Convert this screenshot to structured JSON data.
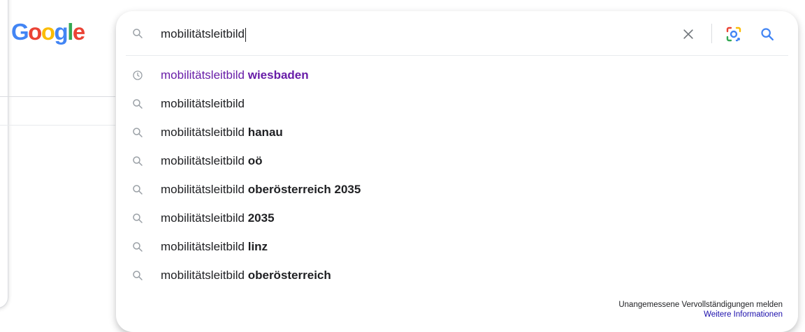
{
  "logo": {
    "text": "Google",
    "letters": [
      {
        "ch": "G",
        "color": "#4285F4"
      },
      {
        "ch": "o",
        "color": "#EA4335"
      },
      {
        "ch": "o",
        "color": "#FBBC05"
      },
      {
        "ch": "g",
        "color": "#4285F4"
      },
      {
        "ch": "l",
        "color": "#34A853"
      },
      {
        "ch": "e",
        "color": "#EA4335"
      }
    ]
  },
  "search": {
    "query": "mobilitätsleitbild",
    "icon": "search-icon",
    "clear_icon": "close-icon",
    "lens_icon": "google-lens-icon",
    "submit_icon": "search-icon"
  },
  "suggestions": [
    {
      "base": "mobilitätsleitbild",
      "suffix": " wiesbaden",
      "icon": "history-icon",
      "visited": true
    },
    {
      "base": "mobilitätsleitbild",
      "suffix": "",
      "icon": "search-icon",
      "visited": false
    },
    {
      "base": "mobilitätsleitbild",
      "suffix": " hanau",
      "icon": "search-icon",
      "visited": false
    },
    {
      "base": "mobilitätsleitbild",
      "suffix": " oö",
      "icon": "search-icon",
      "visited": false
    },
    {
      "base": "mobilitätsleitbild",
      "suffix": " oberösterreich 2035",
      "icon": "search-icon",
      "visited": false
    },
    {
      "base": "mobilitätsleitbild",
      "suffix": " 2035",
      "icon": "search-icon",
      "visited": false
    },
    {
      "base": "mobilitätsleitbild",
      "suffix": " linz",
      "icon": "search-icon",
      "visited": false
    },
    {
      "base": "mobilitätsleitbild",
      "suffix": " oberösterreich",
      "icon": "search-icon",
      "visited": false
    }
  ],
  "footer": {
    "report_label": "Unangemessene Vervollständigungen melden",
    "more_info_label": "Weitere Informationen"
  },
  "colors": {
    "visited_link": "#681da8",
    "link": "#1a0dab",
    "icon_gray": "#9aa0a6",
    "submit_blue": "#4285F4"
  }
}
